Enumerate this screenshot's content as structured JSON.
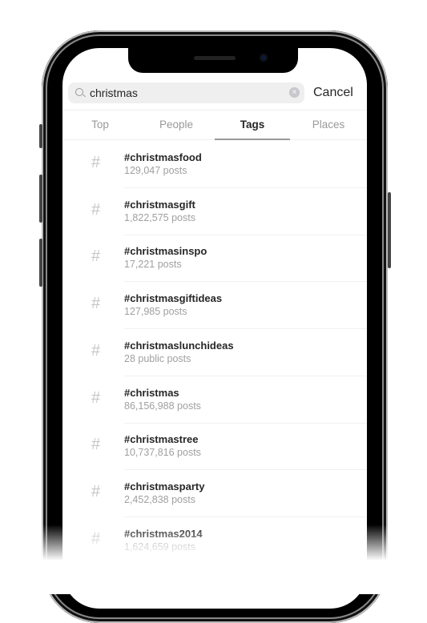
{
  "search": {
    "query": "christmas",
    "cancel_label": "Cancel"
  },
  "tabs": [
    {
      "label": "Top"
    },
    {
      "label": "People"
    },
    {
      "label": "Tags"
    },
    {
      "label": "Places"
    }
  ],
  "active_tab": "Tags",
  "results": [
    {
      "tag": "#christmasfood",
      "count": "129,047 posts"
    },
    {
      "tag": "#christmasgift",
      "count": "1,822,575 posts"
    },
    {
      "tag": "#christmasinspo",
      "count": "17,221 posts"
    },
    {
      "tag": "#christmasgiftideas",
      "count": "127,985 posts"
    },
    {
      "tag": "#christmaslunchideas",
      "count": "28 public posts"
    },
    {
      "tag": "#christmas",
      "count": "86,156,988 posts"
    },
    {
      "tag": "#christmastree",
      "count": "10,737,816 posts"
    },
    {
      "tag": "#christmasparty",
      "count": "2,452,838 posts"
    },
    {
      "tag": "#christmas2014",
      "count": "1,624,659 posts"
    }
  ],
  "icons": {
    "search": "search-icon",
    "clear": "clear-icon",
    "tag": "hashtag-icon"
  }
}
